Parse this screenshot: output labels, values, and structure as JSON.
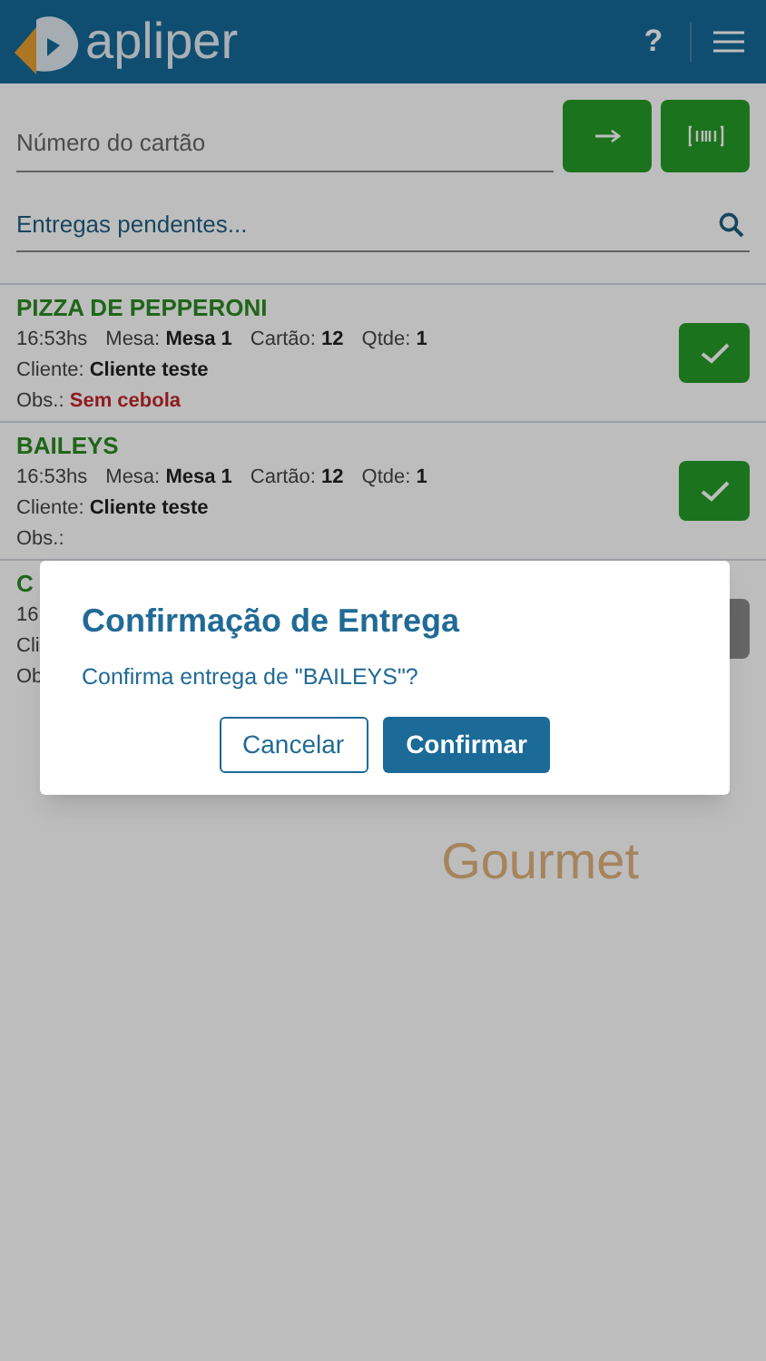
{
  "header": {
    "logo_text": "apliper",
    "help": "?"
  },
  "card_field": {
    "placeholder": "Número do cartão"
  },
  "search": {
    "placeholder": "Entregas pendentes..."
  },
  "orders": [
    {
      "title": "PIZZA DE PEPPERONI",
      "time": "16:53hs",
      "table_label": "Mesa:",
      "table": "Mesa 1",
      "card_label": "Cartão:",
      "card": "12",
      "qty_label": "Qtde:",
      "qty": "1",
      "client_label": "Cliente:",
      "client": "Cliente teste",
      "obs_label": "Obs.:",
      "obs": "Sem cebola",
      "enabled": true
    },
    {
      "title": "BAILEYS",
      "time": "16:53hs",
      "table_label": "Mesa:",
      "table": "Mesa 1",
      "card_label": "Cartão:",
      "card": "12",
      "qty_label": "Qtde:",
      "qty": "1",
      "client_label": "Cliente:",
      "client": "Cliente teste",
      "obs_label": "Obs.:",
      "enabled": true
    },
    {
      "title": "C",
      "time": "16",
      "client_label": "Cli",
      "obs_label": "Ob",
      "enabled": false
    }
  ],
  "background_logo": {
    "subtitle": "Gourmet"
  },
  "dialog": {
    "title": "Confirmação de Entrega",
    "message": "Confirma entrega de \"BAILEYS\"?",
    "buttons": [
      {
        "label": "Cancelar",
        "kind": "secondary"
      },
      {
        "label": "Confirmar",
        "kind": "primary"
      }
    ]
  }
}
